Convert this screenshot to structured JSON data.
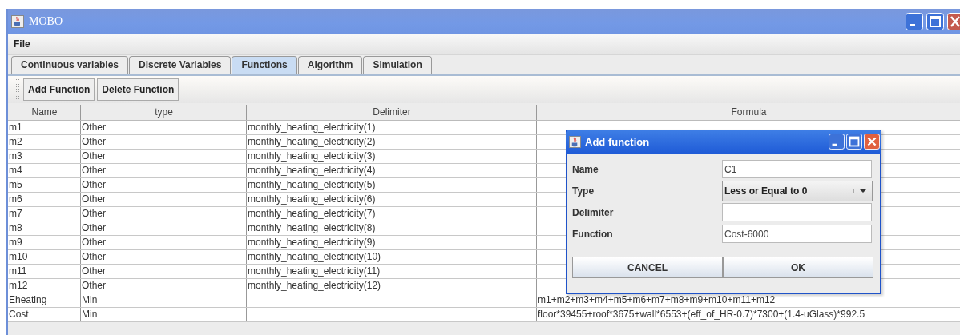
{
  "window": {
    "title": "MOBO"
  },
  "menu": [
    "File"
  ],
  "tabs": [
    {
      "label": "Continuous variables",
      "selected": false
    },
    {
      "label": "Discrete Variables",
      "selected": false
    },
    {
      "label": "Functions",
      "selected": true
    },
    {
      "label": "Algorithm",
      "selected": false
    },
    {
      "label": "Simulation",
      "selected": false
    }
  ],
  "toolbar": [
    "Add Function",
    "Delete Function"
  ],
  "table": {
    "columns": [
      "Name",
      "type",
      "Delimiter",
      "Formula"
    ],
    "rows": [
      {
        "name": "m1",
        "type": "Other",
        "delimiter": "monthly_heating_electricity(1)"
      },
      {
        "name": "m2",
        "type": "Other",
        "delimiter": "monthly_heating_electricity(2)"
      },
      {
        "name": "m3",
        "type": "Other",
        "delimiter": "monthly_heating_electricity(3)"
      },
      {
        "name": "m4",
        "type": "Other",
        "delimiter": "monthly_heating_electricity(4)"
      },
      {
        "name": "m5",
        "type": "Other",
        "delimiter": "monthly_heating_electricity(5)"
      },
      {
        "name": "m6",
        "type": "Other",
        "delimiter": "monthly_heating_electricity(6)"
      },
      {
        "name": "m7",
        "type": "Other",
        "delimiter": "monthly_heating_electricity(7)"
      },
      {
        "name": "m8",
        "type": "Other",
        "delimiter": "monthly_heating_electricity(8)"
      },
      {
        "name": "m9",
        "type": "Other",
        "delimiter": "monthly_heating_electricity(9)"
      },
      {
        "name": "m10",
        "type": "Other",
        "delimiter": "monthly_heating_electricity(10)"
      },
      {
        "name": "m11",
        "type": "Other",
        "delimiter": "monthly_heating_electricity(11)"
      },
      {
        "name": "m12",
        "type": "Other",
        "delimiter": "monthly_heating_electricity(12)"
      },
      {
        "name": "Eheating",
        "type": "Min",
        "formula": "m1+m2+m3+m4+m5+m6+m7+m8+m9+m10+m11+m12"
      },
      {
        "name": "Cost",
        "type": "Min",
        "formula": "floor*39455+roof*3675+wall*6553+(eff_of_HR-0.7)*7300+(1.4-uGlass)*992.5"
      }
    ]
  },
  "dialog": {
    "title": "Add function",
    "fields": [
      {
        "label": "Name",
        "kind": "text",
        "value": "C1"
      },
      {
        "label": "Type",
        "kind": "combo",
        "value": "Less or Equal to 0"
      },
      {
        "label": "Delimiter",
        "kind": "text"
      },
      {
        "label": "Function",
        "kind": "text",
        "value": "Cost-6000"
      }
    ],
    "buttons": [
      "CANCEL",
      "OK"
    ]
  }
}
